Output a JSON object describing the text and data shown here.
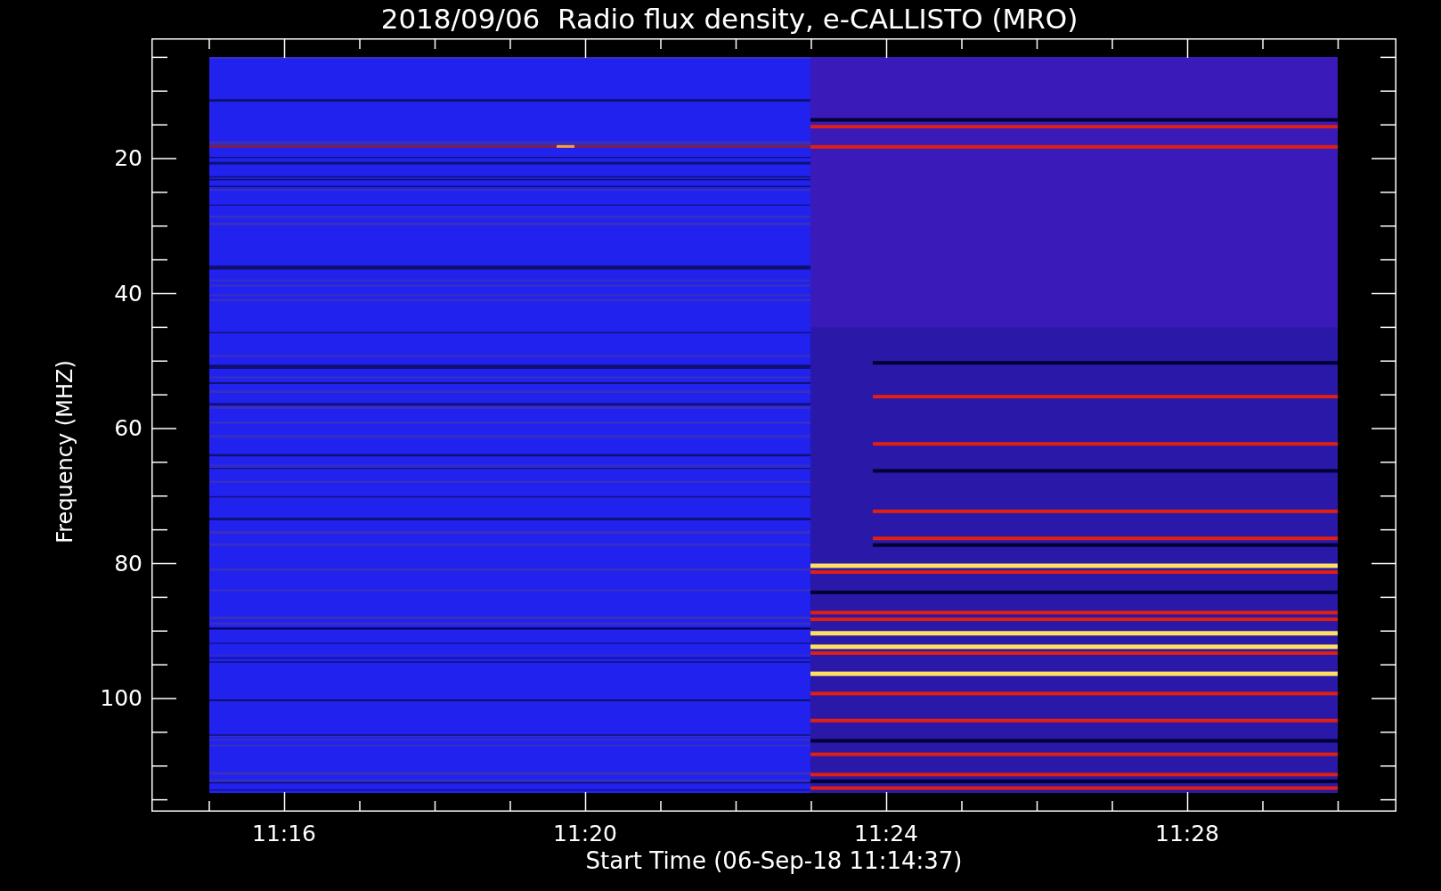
{
  "chart": {
    "title": "2018/09/06  Radio flux density, e-CALLISTO (MRO)",
    "ylabel": "Frequency (MHZ)",
    "xlabel": "Start Time (06-Sep-18 11:14:37)",
    "yticks": [
      "20",
      "40",
      "60",
      "80",
      "100"
    ],
    "xticks": [
      "11:16",
      "11:20",
      "11:24",
      "11:28"
    ]
  }
}
